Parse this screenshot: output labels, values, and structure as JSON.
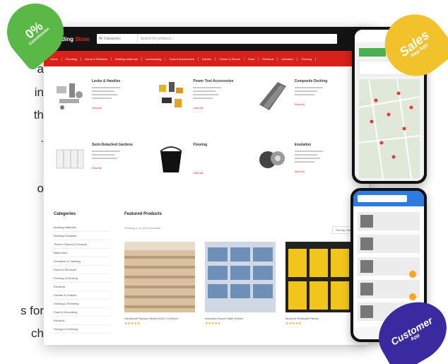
{
  "left_text": {
    "line1": "a",
    "line2": "in",
    "line3": "th",
    "line4": ".",
    "line5": "o",
    "line6": "s for",
    "line7": "ch"
  },
  "badges": {
    "commission": {
      "big": "0%",
      "small": "Commission"
    },
    "sales": {
      "big": "Sales",
      "small": "Rep App"
    },
    "customer": {
      "big": "Customer",
      "small": "App"
    }
  },
  "desktop": {
    "brand_main": "Building",
    "brand_accent": "Store",
    "search_category": "All Categories",
    "search_placeholder": "Search for products...",
    "nav_items": [
      "Home",
      "Plumbing",
      "Doors & Windows",
      "Building Materials",
      "Landscaping",
      "Tools & Accessories",
      "Garden",
      "Timber & Sheets",
      "Paint",
      "Electrical",
      "Insulation",
      "Flooring"
    ],
    "categories": [
      {
        "title": "Locks & Handles",
        "more": "View All"
      },
      {
        "title": "Power Tool Accessories",
        "more": "View All"
      },
      {
        "title": "Composite Decking",
        "more": "View All"
      },
      {
        "title": "Semi-Detached Gardens",
        "more": "View All"
      },
      {
        "title": "Flooring",
        "more": "View All"
      },
      {
        "title": "Insulation",
        "more": "View All"
      }
    ],
    "sidebar": {
      "title": "Categories",
      "items": [
        "Building Materials",
        "Building Hardware",
        "Timber, Plywood & Boards",
        "Bathrooms",
        "Insulation & Cladding",
        "Doors & Windows",
        "Flooring & Decking",
        "Electrical",
        "Garden & Outdoor",
        "Heating & Plumbing",
        "Paint & Decorating",
        "Kitchens",
        "Storage & Shelving"
      ]
    },
    "featured": {
      "title": "Featured Products",
      "subtitle": "Showing 1-12 of 24 products",
      "sort": "Sort by: Default",
      "products": [
        {
          "name": "Hardwood Plywood Sheet 2440 x 1220mm",
          "stars": "★★★★★"
        },
        {
          "name": "Insulation Board Pallet 100mm",
          "stars": "★★★★★"
        },
        {
          "name": "Moisture Resistant Panels",
          "stars": "★★★★★"
        }
      ]
    }
  }
}
